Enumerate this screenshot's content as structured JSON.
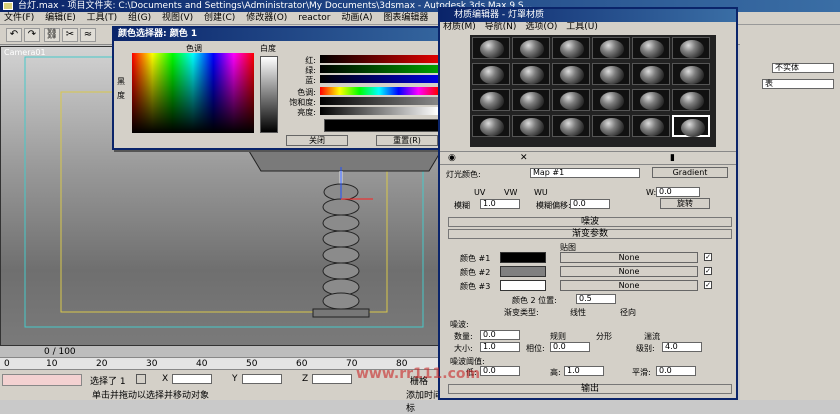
{
  "app": {
    "title": "台灯.max   - 项目文件夹: C:\\Documents and Settings\\Administrator\\My Documents\\3dsmax    - Autodesk 3ds Max 9 S..."
  },
  "menu": [
    "文件(F)",
    "编辑(E)",
    "工具(T)",
    "组(G)",
    "视图(V)",
    "创建(C)",
    "修改器(O)",
    "reactor",
    "动画(A)",
    "图表编辑器"
  ],
  "viewport": {
    "label": "Camera01"
  },
  "timeline": {
    "frame": "0 / 100",
    "ticks": [
      "0",
      "10",
      "20",
      "30",
      "40",
      "50",
      "60",
      "70",
      "80"
    ]
  },
  "status": {
    "selected": "选择了 1",
    "prompt": "单击并拖动以选择并移动对象",
    "add_time": "添加时间标",
    "x_label": "X",
    "y_label": "Y",
    "z_label": "Z",
    "grid_label": "栅格"
  },
  "color_picker": {
    "title": "颜色选择器: 颜色 1",
    "hue_label": "色调",
    "white_label": "白度",
    "black_label": "黑",
    "deg_label": "度",
    "rows": [
      {
        "label": "红:",
        "value": "0",
        "color": "#e00000"
      },
      {
        "label": "绿:",
        "value": "0",
        "color": "#00a000"
      },
      {
        "label": "蓝:",
        "value": "0",
        "color": "#0000e0"
      },
      {
        "label": "色调:",
        "value": "0",
        "color": "hue"
      },
      {
        "label": "饱和度:",
        "value": "0",
        "color": "#808080"
      },
      {
        "label": "亮度:",
        "value": "0",
        "color": "#000000"
      }
    ],
    "close_btn": "关闭",
    "reset_btn": "重置(R)"
  },
  "material_editor": {
    "title": "材质编辑器 - 灯罩材质",
    "menu": [
      "材质(M)",
      "导航(N)",
      "选项(O)",
      "工具(U)"
    ],
    "light_color_label": "灯光颜色:",
    "map_name": "Map #1",
    "type_btn": "Gradient",
    "uvw": [
      "UV",
      "VW",
      "WU"
    ],
    "w_label": "W:",
    "w_value": "0.0",
    "blur_label": "模糊",
    "blur_value": "1.0",
    "blur_offset_label": "模糊偏移:",
    "blur_offset_value": "0.0",
    "rotate_btn": "旋转",
    "rollout_noise": "噪波",
    "rollout_gradient": "渐变参数",
    "maps_label": "贴图",
    "gradient_colors": [
      {
        "label": "颜色 #1",
        "color": "#000000",
        "map": "None"
      },
      {
        "label": "颜色 #2",
        "color": "#808080",
        "map": "None"
      },
      {
        "label": "颜色 #3",
        "color": "#ffffff",
        "map": "None"
      }
    ],
    "color2_pos_label": "颜色 2 位置:",
    "color2_pos_value": "0.5",
    "gradient_type_label": "渐变类型:",
    "gradient_types": [
      "线性",
      "径向"
    ],
    "noise_section": "噪波:",
    "amount_label": "数量:",
    "amount_value": "0.0",
    "size_label": "大小:",
    "size_value": "1.0",
    "phase_label": "相位:",
    "phase_value": "0.0",
    "level_label": "级别:",
    "level_value": "4.0",
    "noise_types": [
      "规则",
      "分形",
      "湍流"
    ],
    "threshold_section": "噪波阈值:",
    "low_label": "低:",
    "low_value": "0.0",
    "high_label": "高:",
    "high_value": "1.0",
    "smooth_label": "平滑:",
    "smooth_value": "0.0",
    "rollout_output": "输出"
  },
  "right_panel": {
    "mat_name": "不实体",
    "list_item": "表"
  },
  "watermark": "www.rr111.com"
}
